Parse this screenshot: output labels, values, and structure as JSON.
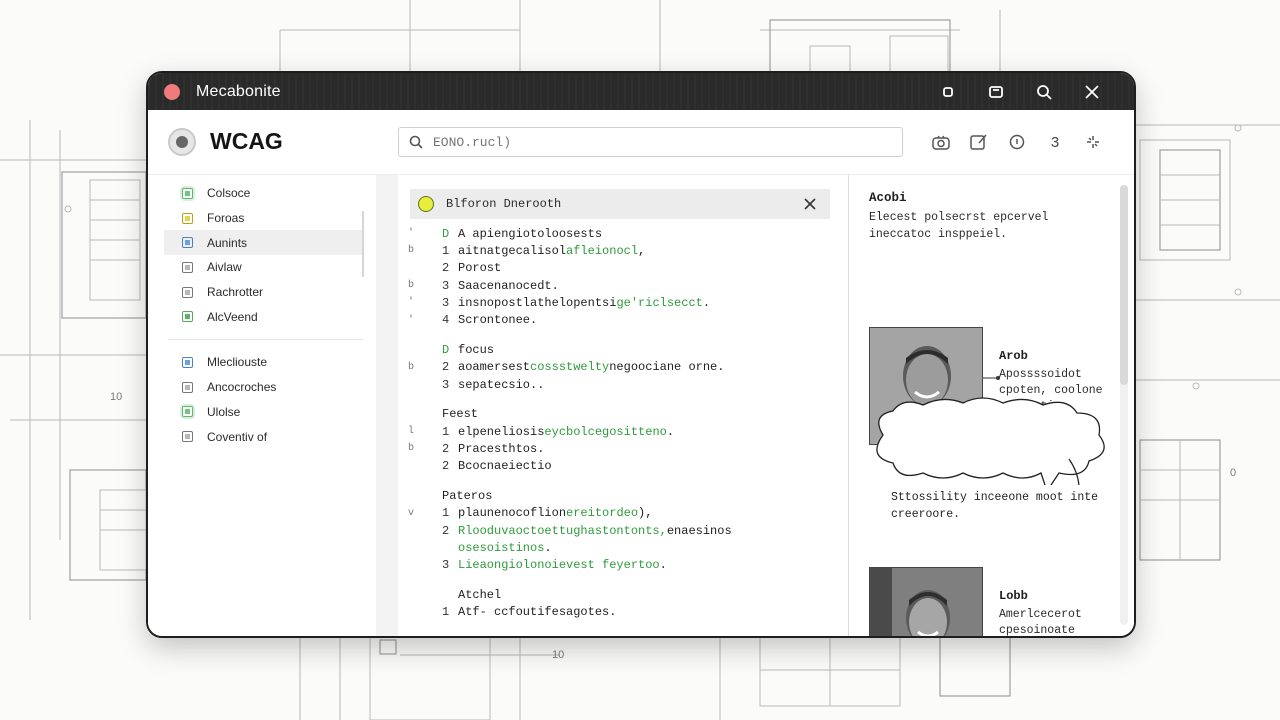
{
  "window": {
    "title": "Mecabonite"
  },
  "header": {
    "brand": "WCAG",
    "search": {
      "value": "EONO...",
      "placeholder": "EONO.rucl)"
    },
    "tools": [
      {
        "name": "camera-icon"
      },
      {
        "name": "compose-icon"
      },
      {
        "name": "info-icon"
      },
      {
        "label": "3"
      },
      {
        "name": "sparkle-icon"
      }
    ]
  },
  "sidebar": {
    "group1": [
      {
        "label": "Colsoce",
        "icon": "green"
      },
      {
        "label": "Foroas",
        "icon": "yellow"
      },
      {
        "label": "Aunints",
        "icon": "blue",
        "active": true
      },
      {
        "label": "Aivlaw",
        "icon": "gray"
      },
      {
        "label": "Rachrotter",
        "icon": "gray"
      },
      {
        "label": "AlcVeend",
        "icon": "greenbox"
      }
    ],
    "group2": [
      {
        "label": "Mlecliouste",
        "icon": "blue"
      },
      {
        "label": "Ancocroches",
        "icon": "gray"
      },
      {
        "label": "Ulolse",
        "icon": "green"
      },
      {
        "label": "Coventiv of",
        "icon": "gray"
      }
    ]
  },
  "document": {
    "title": "Blforon Dnerooth",
    "sections": [
      {
        "lines": [
          {
            "gut": "'",
            "num": "D",
            "numGreen": true,
            "text": "A apiengiotoloosests",
            "green": ""
          },
          {
            "gut": "b",
            "num": "1",
            "text": "aitnatgecalisol ",
            "green": "afleionocl",
            "tail": ","
          },
          {
            "gut": "",
            "num": "2",
            "text": "Porost",
            "green": ""
          },
          {
            "gut": "b",
            "num": "3",
            "text": "Saacenanocedt.",
            "green": ""
          },
          {
            "gut": "'",
            "num": "3",
            "text": "insnopostlathelopentsi",
            "green": "ge'riclsecct",
            "tail": "."
          },
          {
            "gut": "'",
            "num": "4",
            "text": "Scrontonee.",
            "green": ""
          }
        ]
      },
      {
        "lines": [
          {
            "gut": "",
            "num": "D",
            "numGreen": true,
            "text": "focus",
            "green": ""
          },
          {
            "gut": "b",
            "num": "2",
            "text": "aoamersest ",
            "green": "cossstwelty",
            "tail": " negoociane orne."
          },
          {
            "gut": "",
            "num": "3",
            "text": "sepatecsio..",
            "green": ""
          }
        ]
      },
      {
        "heading": "Feest",
        "lines": [
          {
            "gut": "l",
            "num": "1",
            "text": "elpeneliosis ",
            "green": "eycbolcegositteno",
            "tail": "."
          },
          {
            "gut": "b",
            "num": "2",
            "text": "Pracesthtos.",
            "green": ""
          },
          {
            "gut": "",
            "num": "2",
            "text": "Bcocnaeiectio",
            "green": ""
          }
        ]
      },
      {
        "heading": "Pateros",
        "lines": [
          {
            "gut": "v",
            "num": "1",
            "text": "plaunenocoflion ",
            "green": "ereitordeo",
            "tail": "),"
          },
          {
            "gut": "",
            "num": "2",
            "text": "",
            "green": "Rlooduvaoctoettughastontonts,",
            "tail": " enaesinos"
          },
          {
            "gut": "",
            "num": "",
            "text": "",
            "green": "osesoistinos",
            "tail": "."
          },
          {
            "gut": "",
            "num": "3",
            "text": "",
            "green": "Lieaongiolonoievest feyertoo",
            "tail": "."
          }
        ]
      },
      {
        "heading": "Atchel",
        "indentHeading": true,
        "lines": [
          {
            "gut": "",
            "num": "1",
            "text": "Atf- ccfoutifesagotes",
            "green": "",
            "tail": "."
          }
        ]
      }
    ]
  },
  "panel": {
    "title": "Acobi",
    "desc": "Elecest polsecrst epcervel ineccatoc insppeiel.",
    "people": [
      {
        "name": "Arob",
        "desc": "Apossssoidot cpoten, coolone oroseotio."
      },
      {
        "name": "Lobb",
        "desc": "Amerlcecerot cpesoinoate vwgps, pookle seeoces."
      }
    ],
    "bubble": "Sttossility inceeone moot inte creeroore."
  }
}
